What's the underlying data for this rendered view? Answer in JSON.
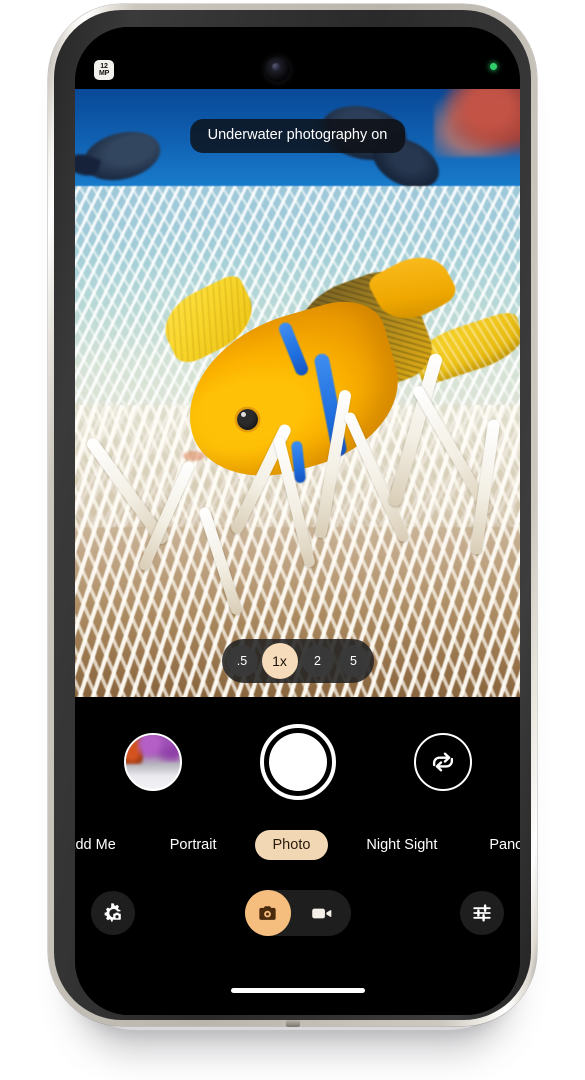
{
  "device": {
    "name": "smartphone-mockup",
    "frame_color": "#c6c2ba",
    "screen_bg": "#000000"
  },
  "status_bar": {
    "mp_badge_top": "12",
    "mp_badge_bottom": "MP",
    "mp_badge_name": "12-megapixel-badge",
    "front_camera": "front-camera-punch-hole",
    "privacy_indicator": "camera-in-use-green-dot",
    "privacy_color": "#2fd06a"
  },
  "viewfinder": {
    "scene": "underwater coral reef with a yellow clownfish among white sea anemone tentacles",
    "toast": "Underwater photography on",
    "zoom": {
      "name": "zoom-level-selector",
      "selected": "1x",
      "options": [
        " .5",
        "1x",
        "2",
        "5"
      ],
      "selected_bg": "#f7dcbb",
      "selected_fg": "#1b1208"
    }
  },
  "controls": {
    "gallery_thumbnail": "last-photo-thumbnail",
    "shutter": "shutter-button",
    "flip_camera": "switch-camera-button",
    "modes": [
      {
        "label": "Add Me",
        "selected": false
      },
      {
        "label": "Portrait",
        "selected": false
      },
      {
        "label": "Photo",
        "selected": true
      },
      {
        "label": "Night Sight",
        "selected": false
      },
      {
        "label": "Pano",
        "selected": false
      }
    ],
    "mode_selected_bg": "#f2d7b5",
    "mode_selected_fg": "#2a1c0c"
  },
  "toolbar": {
    "settings": "camera-settings-button",
    "photo_video_toggle": {
      "name": "photo-video-mode-toggle",
      "selected": "photo",
      "photo_icon": "camera-icon",
      "video_icon": "video-camera-icon",
      "active_bg": "#f5bd7e"
    },
    "tune": "adjust-settings-button"
  },
  "system": {
    "home_indicator": "home-gesture-bar"
  }
}
